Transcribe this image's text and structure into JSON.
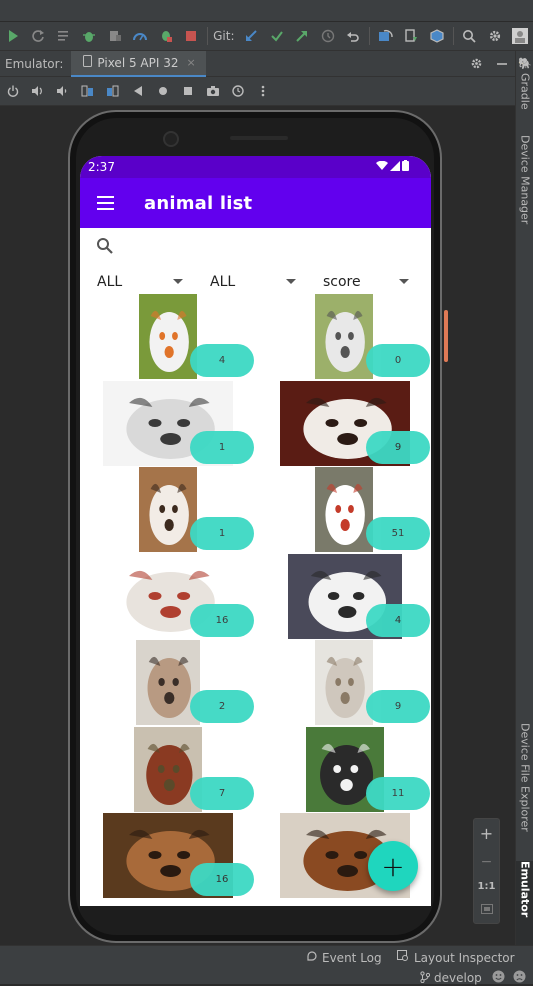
{
  "toolbar": {
    "git_label": "Git:"
  },
  "emulator_header": {
    "title": "Emulator:",
    "tab_label": "Pixel 5 API 32",
    "tab_close": "×"
  },
  "side_tabs": {
    "gradle": "Gradle",
    "device_manager": "Device Manager",
    "device_file_explorer": "Device File Explorer",
    "emulator": "Emulator"
  },
  "zoom_panel": {
    "plus": "+",
    "minus": "−",
    "one_to_one": "1:1"
  },
  "status_bar": {
    "event_log": "Event Log",
    "layout_inspector": "Layout Inspector",
    "branch": "develop"
  },
  "phone": {
    "time": "2:37",
    "app_title": "animal list",
    "filters": [
      "ALL",
      "ALL",
      "score"
    ],
    "fab_label": "+",
    "dogs": [
      {
        "score": "4",
        "palette": [
          "#7a9a3a",
          "#f2f2f2",
          "#e0742a"
        ]
      },
      {
        "score": "0",
        "palette": [
          "#9cb06a",
          "#e8e8e8",
          "#555555"
        ]
      },
      {
        "score": "1",
        "palette": [
          "#f4f4f4",
          "#d9d9d9",
          "#3a3a3a"
        ]
      },
      {
        "score": "9",
        "palette": [
          "#5a1c14",
          "#f0ebe6",
          "#2b1a14"
        ]
      },
      {
        "score": "1",
        "palette": [
          "#a5744a",
          "#f2ece6",
          "#3c2a1e"
        ]
      },
      {
        "score": "51",
        "palette": [
          "#7a7a6a",
          "#ffffff",
          "#c43b2a"
        ]
      },
      {
        "score": "16",
        "palette": [
          "#ffffff",
          "#e8e3dd",
          "#b04030"
        ]
      },
      {
        "score": "4",
        "palette": [
          "#4a4a5a",
          "#f2f2f2",
          "#2a2a2a"
        ]
      },
      {
        "score": "2",
        "palette": [
          "#d9d4cc",
          "#b89a82",
          "#3a2e28"
        ]
      },
      {
        "score": "9",
        "palette": [
          "#e6e4df",
          "#cfc7bd",
          "#8a7a66"
        ]
      },
      {
        "score": "7",
        "palette": [
          "#c9c0b0",
          "#8a3a22",
          "#5a4a2a"
        ]
      },
      {
        "score": "11",
        "palette": [
          "#4a7a3a",
          "#2a2a2a",
          "#f2f2f2"
        ]
      },
      {
        "score": "16",
        "palette": [
          "#5a3a1e",
          "#a86a3a",
          "#2a1a10"
        ]
      },
      {
        "score": "",
        "palette": [
          "#d9d0c4",
          "#8a4a22",
          "#2a1a10"
        ]
      }
    ]
  }
}
